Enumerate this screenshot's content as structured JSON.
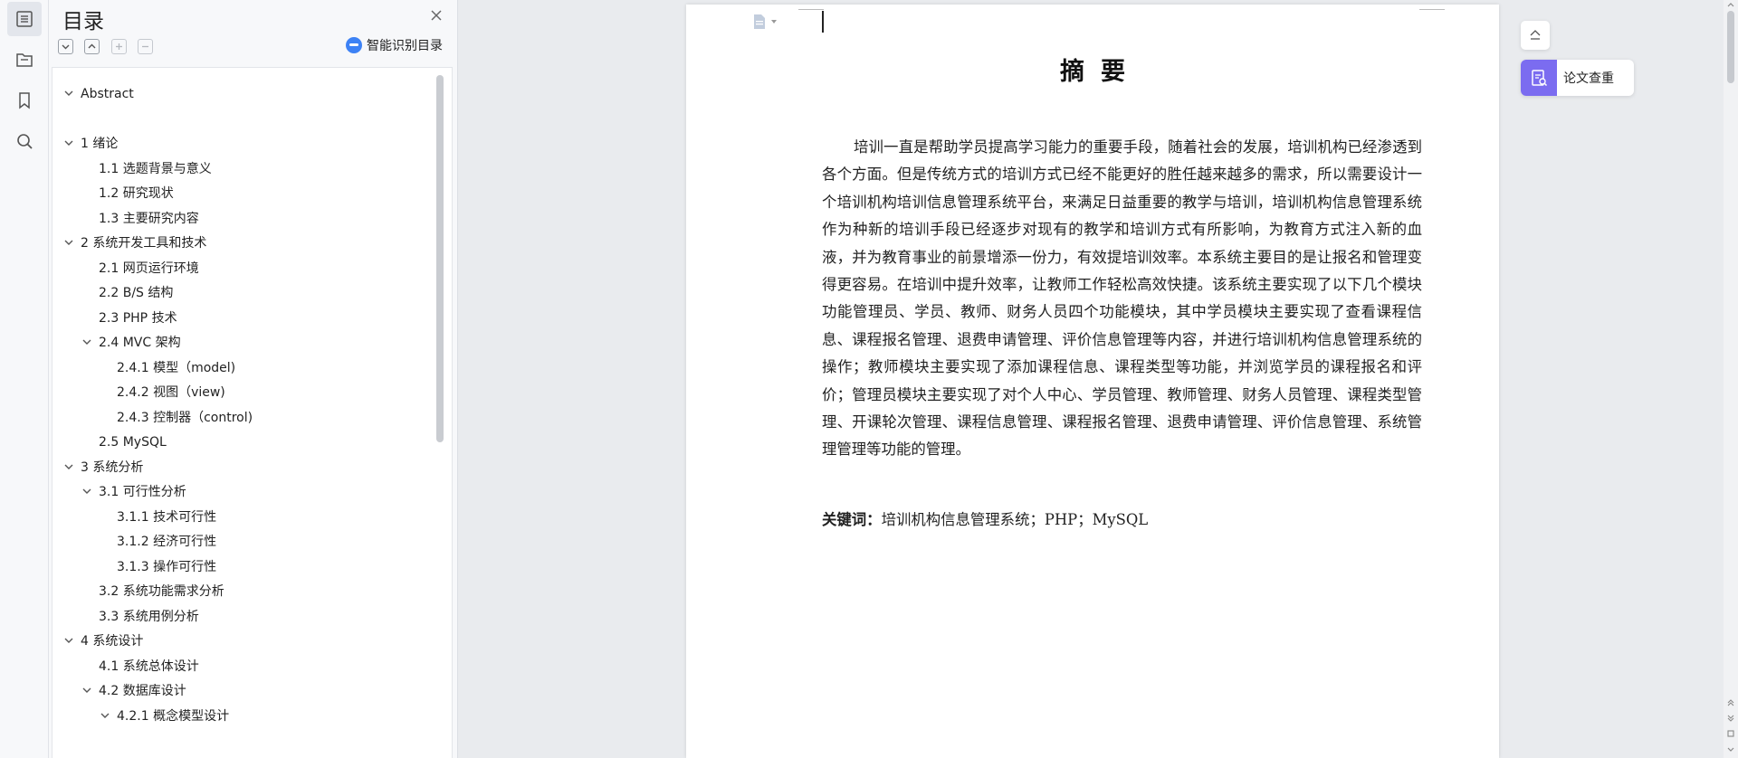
{
  "rail": {
    "items": [
      {
        "name": "outline-icon",
        "active": true
      },
      {
        "name": "folder-icon",
        "active": false
      },
      {
        "name": "bookmark-icon",
        "active": false
      },
      {
        "name": "search-icon",
        "active": false
      }
    ]
  },
  "outline": {
    "title": "目录",
    "ai_button_label": "智能识别目录",
    "items": [
      {
        "label": "Abstract",
        "level": 0,
        "chevron": true
      },
      {
        "label": "1  绪论",
        "level": 0,
        "chevron": true
      },
      {
        "label": "1.1  选题背景与意义",
        "level": 1,
        "chevron": false
      },
      {
        "label": "1.2  研究现状",
        "level": 1,
        "chevron": false
      },
      {
        "label": "1.3  主要研究内容",
        "level": 1,
        "chevron": false
      },
      {
        "label": "2  系统开发工具和技术",
        "level": 0,
        "chevron": true
      },
      {
        "label": "2.1 网页运行环境",
        "level": 1,
        "chevron": false
      },
      {
        "label": "2.2 B/S 结构",
        "level": 1,
        "chevron": false
      },
      {
        "label": "2.3 PHP 技术",
        "level": 1,
        "chevron": false
      },
      {
        "label": "2.4 MVC 架构",
        "level": 1,
        "chevron": true
      },
      {
        "label": "2.4.1 模型（model)",
        "level": 2,
        "chevron": false
      },
      {
        "label": "2.4.2 视图（view)",
        "level": 2,
        "chevron": false
      },
      {
        "label": "2.4.3 控制器（control)",
        "level": 2,
        "chevron": false
      },
      {
        "label": "2.5 MySQL",
        "level": 1,
        "chevron": false
      },
      {
        "label": "3    系统分析",
        "level": 0,
        "chevron": true
      },
      {
        "label": "3.1  可行性分析",
        "level": 1,
        "chevron": true
      },
      {
        "label": "3.1.1  技术可行性",
        "level": 2,
        "chevron": false
      },
      {
        "label": "3.1.2  经济可行性",
        "level": 2,
        "chevron": false
      },
      {
        "label": "3.1.3  操作可行性",
        "level": 2,
        "chevron": false
      },
      {
        "label": "3.2  系统功能需求分析",
        "level": 1,
        "chevron": false
      },
      {
        "label": "3.3  系统用例分析",
        "level": 1,
        "chevron": false
      },
      {
        "label": "4    系统设计",
        "level": 0,
        "chevron": true
      },
      {
        "label": "4.1  系统总体设计",
        "level": 1,
        "chevron": false
      },
      {
        "label": "4.2  数据库设计",
        "level": 1,
        "chevron": true
      },
      {
        "label": "4.2.1  概念模型设计",
        "level": 2,
        "chevron": true
      }
    ]
  },
  "document": {
    "title": "摘要",
    "body": "培训一直是帮助学员提高学习能力的重要手段，随着社会的发展，培训机构已经渗透到各个方面。但是传统方式的培训方式已经不能更好的胜任越来越多的需求，所以需要设计一个培训机构培训信息管理系统平台，来满足日益重要的教学与培训，培训机构信息管理系统作为种新的培训手段已经逐步对现有的教学和培训方式有所影响，为教育方式注入新的血液，并为教育事业的前景增添一份力，有效提培训效率。本系统主要目的是让报名和管理变得更容易。在培训中提升效率，让教师工作轻松高效快捷。该系统主要实现了以下几个模块功能管理员、学员、教师、财务人员四个功能模块，其中学员模块主要实现了查看课程信息、课程报名管理、退费申请管理、评价信息管理等内容，并进行培训机构信息管理系统的操作；教师模块主要实现了添加课程信息、课程类型等功能，并浏览学员的课程报名和评价；管理员模块主要实现了对个人中心、学员管理、教师管理、财务人员管理、课程类型管理、开课轮次管理、课程信息管理、课程报名管理、退费申请管理、评价信息管理、系统管理管理等功能的管理。",
    "keywords_label": "关键词：",
    "keywords": "培训机构信息管理系统；PHP；MySQL"
  },
  "right_panel": {
    "check_label": "论文查重"
  },
  "colors": {
    "accent": "#3d82f5",
    "check_icon_bg": "#7b6cf0"
  }
}
